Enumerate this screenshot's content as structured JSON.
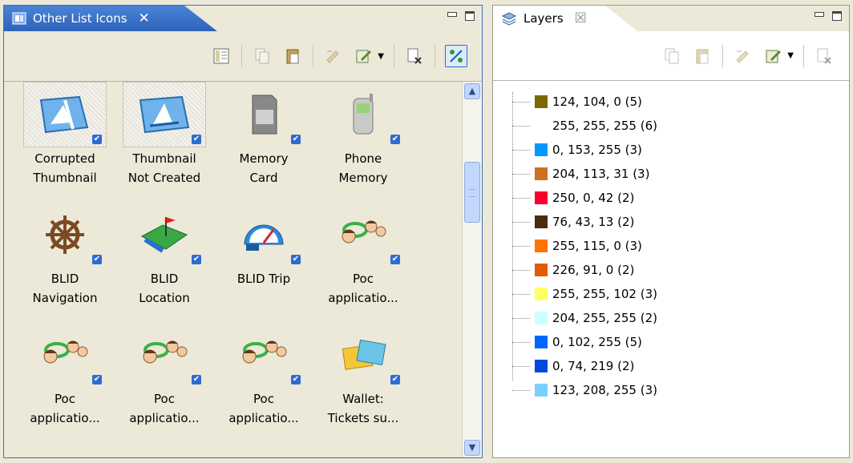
{
  "left_view": {
    "tab_title": "Other List Icons",
    "tab_close": "✕",
    "items": [
      {
        "caption": "Corrupted\nThumbnail",
        "icon": "corrupted-thumbnail-icon",
        "checked": true,
        "selected": true
      },
      {
        "caption": "Thumbnail\nNot Created",
        "icon": "thumbnail-not-created-icon",
        "checked": true,
        "selected": true
      },
      {
        "caption": "Memory\nCard",
        "icon": "memory-card-icon",
        "checked": true,
        "selected": false
      },
      {
        "caption": "Phone\nMemory",
        "icon": "phone-memory-icon",
        "checked": true,
        "selected": false
      },
      {
        "caption": "BLID\nNavigation",
        "icon": "ship-wheel-icon",
        "checked": true,
        "selected": false
      },
      {
        "caption": "BLID\nLocation",
        "icon": "map-flag-icon",
        "checked": true,
        "selected": false
      },
      {
        "caption": "BLID Trip",
        "icon": "speedometer-icon",
        "checked": true,
        "selected": false
      },
      {
        "caption": "Poc\napplicatio...",
        "icon": "people-connect-icon",
        "checked": true,
        "selected": false
      },
      {
        "caption": "Poc\napplicatio...",
        "icon": "people-connect-icon",
        "checked": true,
        "selected": false
      },
      {
        "caption": "Poc\napplicatio...",
        "icon": "people-connect-icon",
        "checked": true,
        "selected": false
      },
      {
        "caption": "Poc\napplicatio...",
        "icon": "people-connect-icon",
        "checked": true,
        "selected": false
      },
      {
        "caption": "Wallet:\nTickets su...",
        "icon": "tickets-icon",
        "checked": true,
        "selected": false
      }
    ]
  },
  "right_view": {
    "tab_title": "Layers",
    "tab_close": "☒",
    "layers": [
      {
        "label": "124, 104, 0 (5)",
        "color": "#7c6800"
      },
      {
        "label": "255, 255, 255 (6)",
        "color": "#ffffff"
      },
      {
        "label": "0, 153, 255 (3)",
        "color": "#0099ff"
      },
      {
        "label": "204, 113, 31 (3)",
        "color": "#cc711f"
      },
      {
        "label": "250, 0, 42 (2)",
        "color": "#fa002a"
      },
      {
        "label": "76, 43, 13 (2)",
        "color": "#4c2b0d"
      },
      {
        "label": "255, 115, 0 (3)",
        "color": "#ff7300"
      },
      {
        "label": "226, 91, 0 (2)",
        "color": "#e25b00"
      },
      {
        "label": "255, 255, 102 (3)",
        "color": "#ffff66"
      },
      {
        "label": "204, 255, 255 (2)",
        "color": "#ccffff"
      },
      {
        "label": "0, 102, 255 (5)",
        "color": "#0066ff"
      },
      {
        "label": "0, 74, 219 (2)",
        "color": "#004adb"
      },
      {
        "label": "123, 208, 255 (3)",
        "color": "#7bd0ff"
      }
    ]
  },
  "colors": {
    "active_tab": "#3a74cc",
    "checkbox": "#2f6bd1",
    "panel_bg": "#ece9d8"
  }
}
